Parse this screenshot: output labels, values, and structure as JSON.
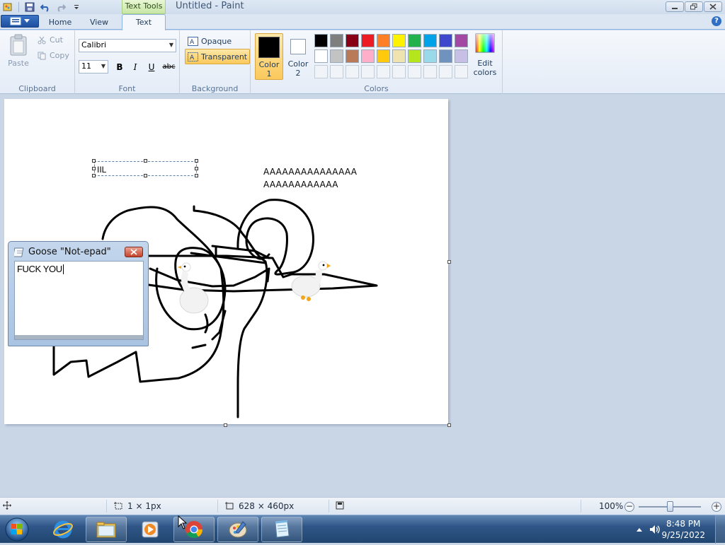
{
  "window": {
    "title": "Untitled - Paint",
    "contextual_tab_group": "Text Tools"
  },
  "tabs": [
    {
      "label": "Home"
    },
    {
      "label": "View"
    },
    {
      "label": "Text"
    }
  ],
  "ribbon": {
    "clipboard": {
      "paste_label": "Paste",
      "cut_label": "Cut",
      "copy_label": "Copy",
      "group_label": "Clipboard"
    },
    "font": {
      "family": "Calibri",
      "size": "11",
      "bold": "B",
      "italic": "I",
      "underline": "U",
      "strike": "abc",
      "group_label": "Font"
    },
    "background": {
      "opaque_label": "Opaque",
      "transparent_label": "Transparent",
      "group_label": "Background"
    },
    "colors": {
      "color1_label": "Color\n1",
      "color1_word": "Color",
      "color1_num": "1",
      "color2_word": "Color",
      "color2_num": "2",
      "color1_value": "#000000",
      "color2_value": "#ffffff",
      "edit_colors_word1": "Edit",
      "edit_colors_word2": "colors",
      "group_label": "Colors",
      "palette_row1": [
        "#000000",
        "#7f7f7f",
        "#880015",
        "#ed1c24",
        "#ff7f27",
        "#fff200",
        "#22b14c",
        "#00a2e8",
        "#3f48cc",
        "#a349a4"
      ],
      "palette_row2": [
        "#ffffff",
        "#c3c3c3",
        "#b97a57",
        "#ffaec9",
        "#ffc90e",
        "#efe4b0",
        "#b5e61d",
        "#99d9ea",
        "#7092be",
        "#c8bfe7"
      ]
    }
  },
  "canvas": {
    "typed_text": "IIL",
    "text_line1": "AAAAAAAAAAAAAAA",
    "text_line2": "AAAAAAAAAAAA"
  },
  "goose_notepad": {
    "title": "Goose \"Not-epad\"",
    "content": "FUCK YOU"
  },
  "statusbar": {
    "selection_size": "1 × 1px",
    "image_size": "628 × 460px",
    "zoom": "100%",
    "zoom_level_fraction": 0.5
  },
  "taskbar": {
    "time": "8:48 PM",
    "date": "9/25/2022"
  }
}
